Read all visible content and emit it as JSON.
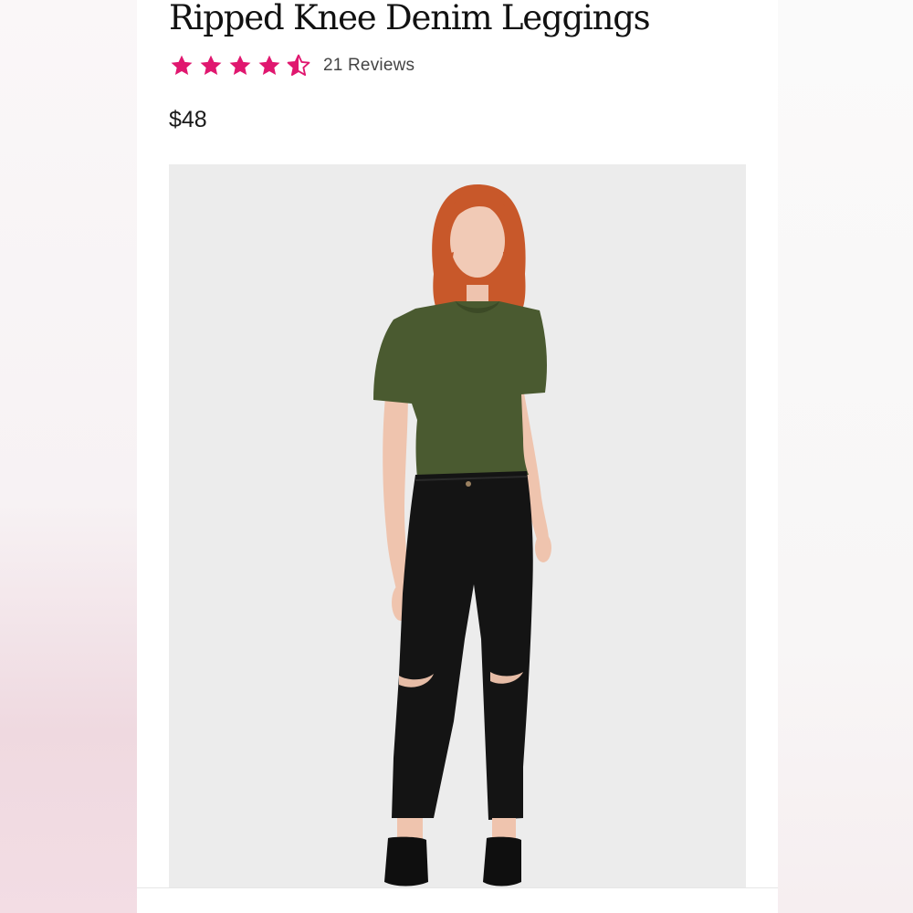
{
  "product": {
    "title": "Ripped Knee Denim Leggings",
    "rating": 4.5,
    "rating_max": 5,
    "reviews_label": "21 Reviews",
    "price": "$48",
    "star_color": "#e0176f",
    "star_icon": "star-icon",
    "half_star_icon": "half-star-icon",
    "image": {
      "top_color": "#4a5a30",
      "pants_color": "#141414",
      "hair_color": "#c8582a"
    }
  }
}
